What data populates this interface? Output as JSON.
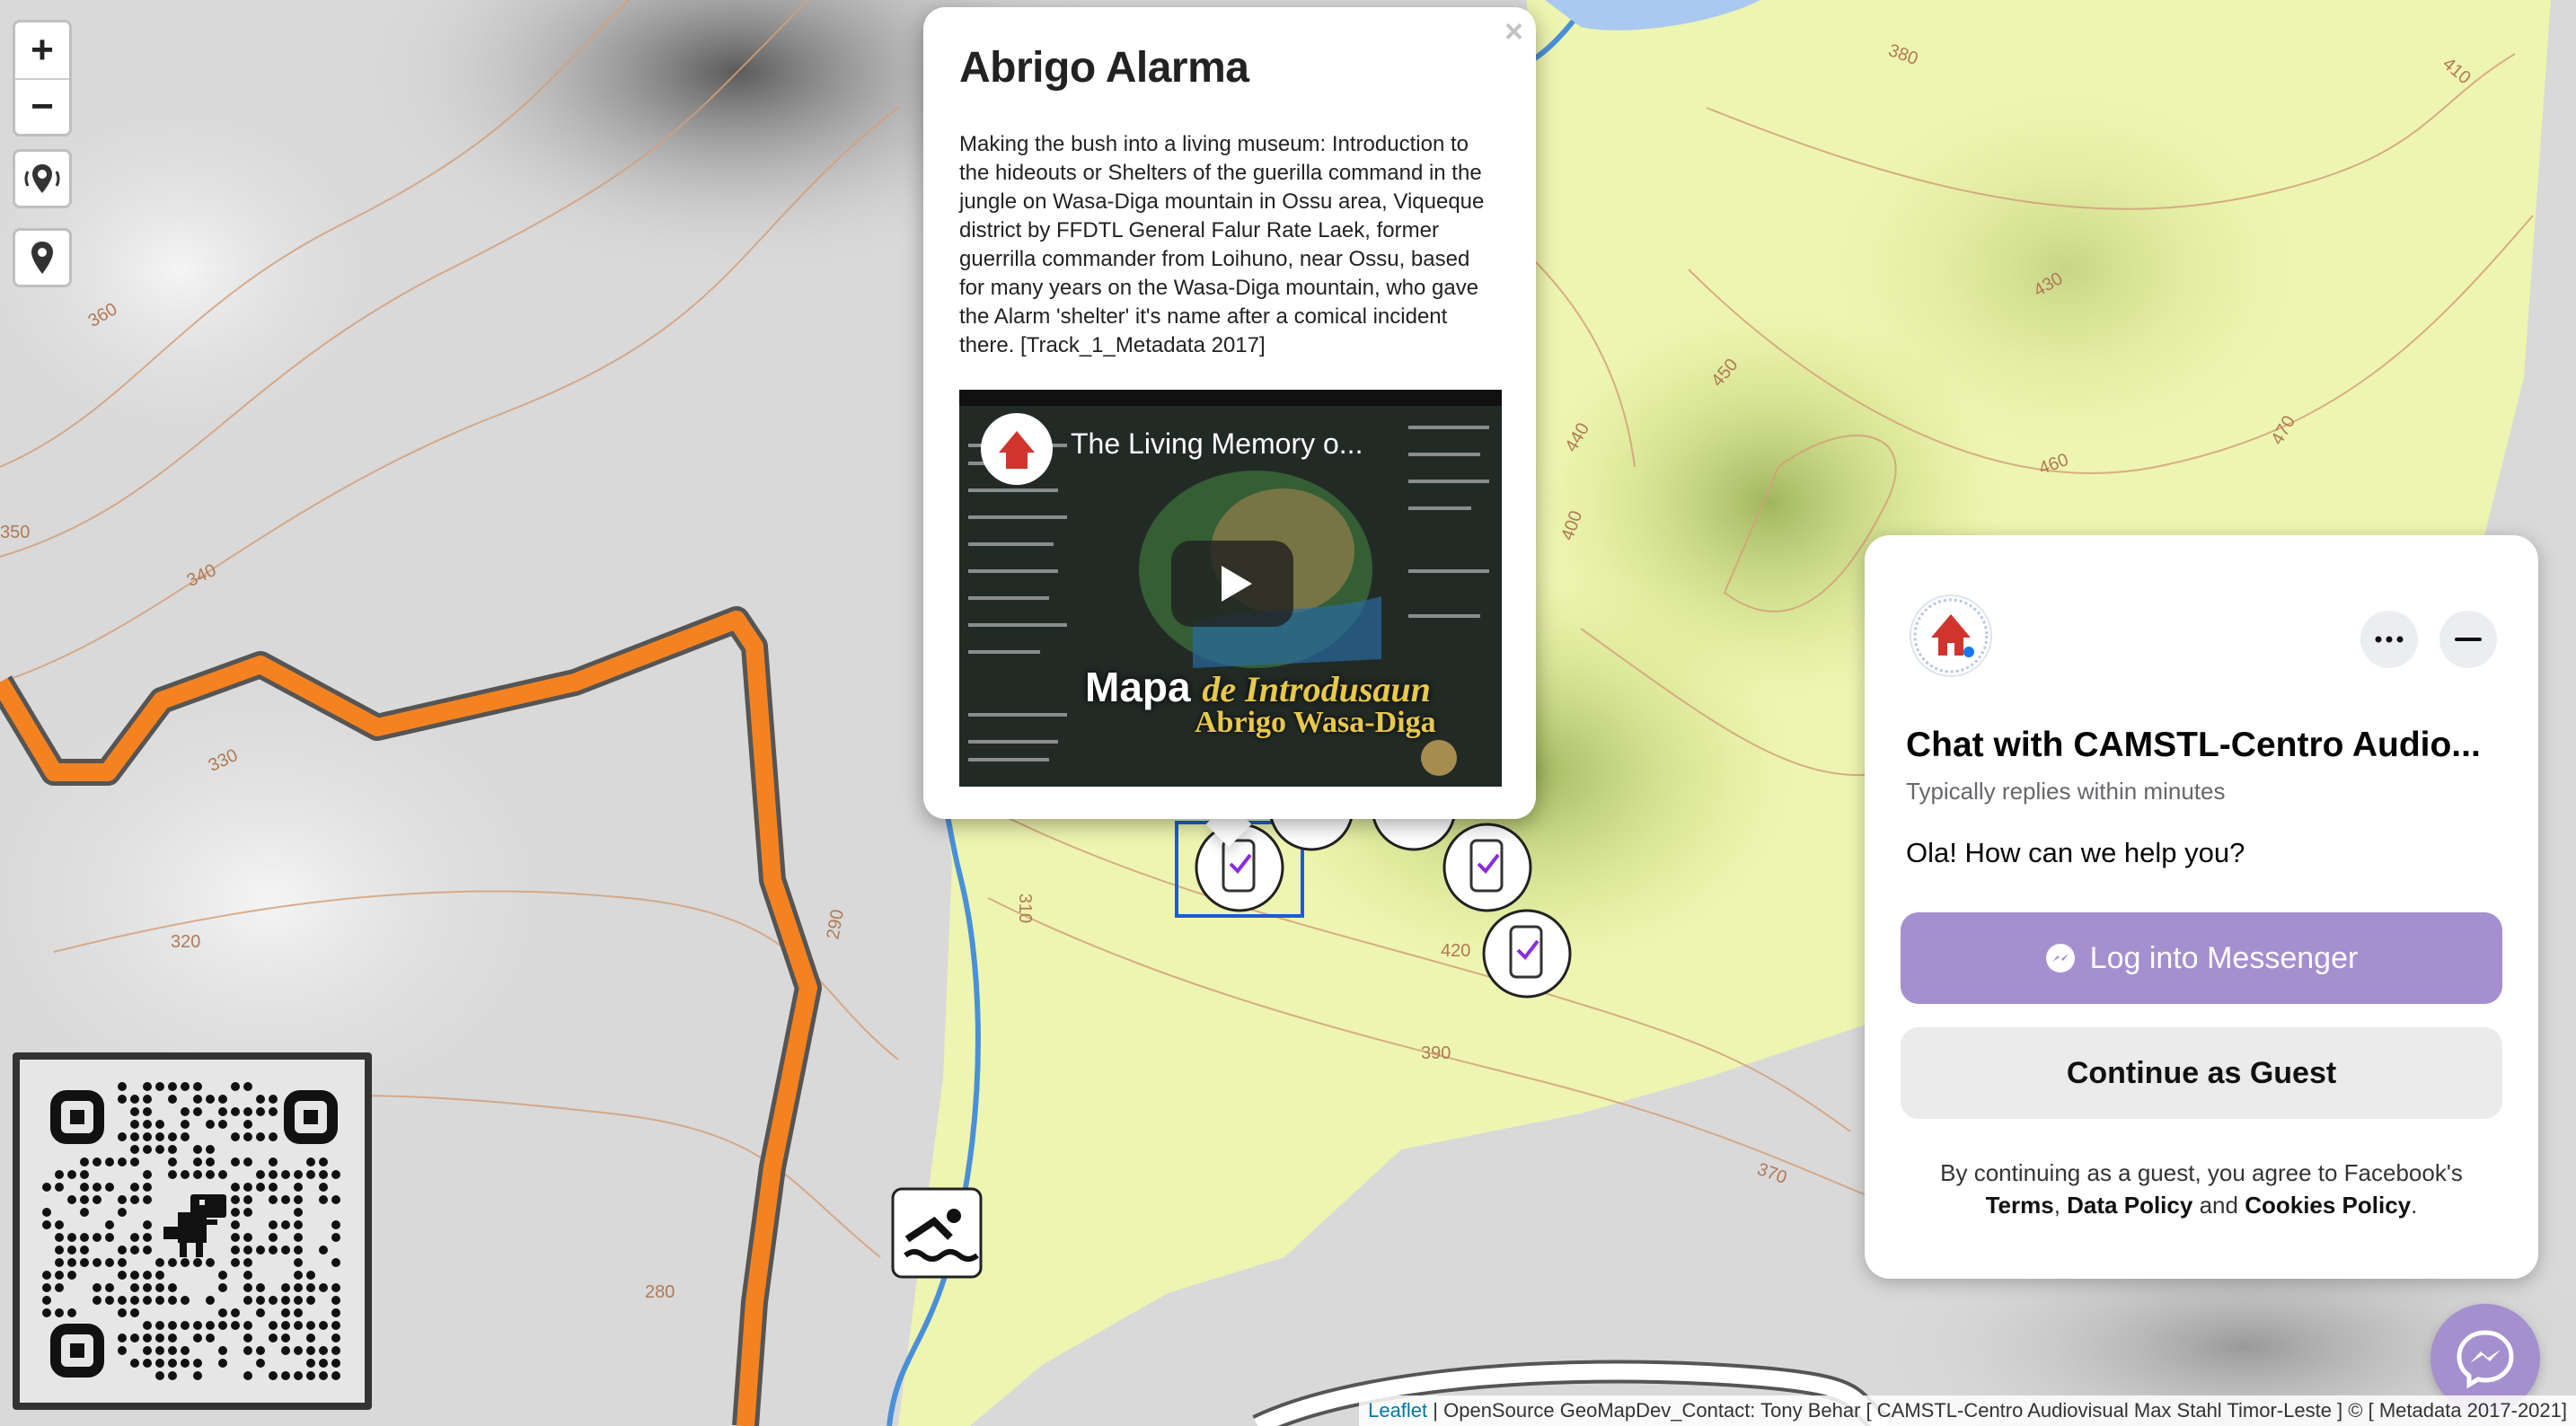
{
  "map": {
    "contour_labels": [
      "380",
      "410",
      "430",
      "450",
      "460",
      "470",
      "440",
      "400",
      "370",
      "360",
      "350",
      "340",
      "330",
      "320",
      "310",
      "290",
      "280",
      "420",
      "390"
    ],
    "colors": {
      "base": "#d9d9d9",
      "forest": "#eef5b0",
      "forest_shade": "#c8de7a",
      "road": "#f58220",
      "road_casing": "#555555",
      "river": "#4a90d9",
      "contour": "#d4a07a"
    }
  },
  "controls": {
    "zoom_in": "+",
    "zoom_out": "−",
    "locate_icon": "location-broadcast-icon",
    "marker_icon": "map-pin-icon"
  },
  "markers": {
    "icon": "phone-checkmark-icon",
    "count": 6,
    "poi_icon": "swimming-icon"
  },
  "popup": {
    "close": "×",
    "title": "Abrigo Alarma",
    "description": "Making the bush into a living museum: Introduction to the hideouts or Shelters of the guerilla command in the jungle on Wasa-Diga mountain in Ossu area, Viqueque district by FFDTL General Falur Rate Laek, former guerrilla commander from Loihuno, near Ossu, based for many years on the Wasa-Diga mountain, who gave the Alarm 'shelter' it's name after a comical incident there. [Track_1_Metadata 2017]",
    "video": {
      "title": "The Living Memory o...",
      "caption_big": "Mapa",
      "caption_script": "de Introdusaun",
      "caption_sub": "Abrigo Wasa-Diga"
    }
  },
  "chat": {
    "title": "Chat with CAMSTL-Centro Audio...",
    "subtitle": "Typically replies within minutes",
    "greeting": "Ola! How can we help you?",
    "messenger_button": "Log into Messenger",
    "guest_button": "Continue as Guest",
    "legal_prefix": "By continuing as a guest, you agree to Facebook's",
    "terms": "Terms",
    "data_policy": "Data Policy",
    "and": "and",
    "cookies_policy": "Cookies Policy",
    "accent": "#a58fcf"
  },
  "attribution": {
    "leaflet": "Leaflet",
    "rest": "OpenSource GeoMapDev_Contact: Tony Behar [ CAMSTL-Centro Audiovisual Max Stahl Timor-Leste ] © [ Metadata 2017-2021]"
  }
}
